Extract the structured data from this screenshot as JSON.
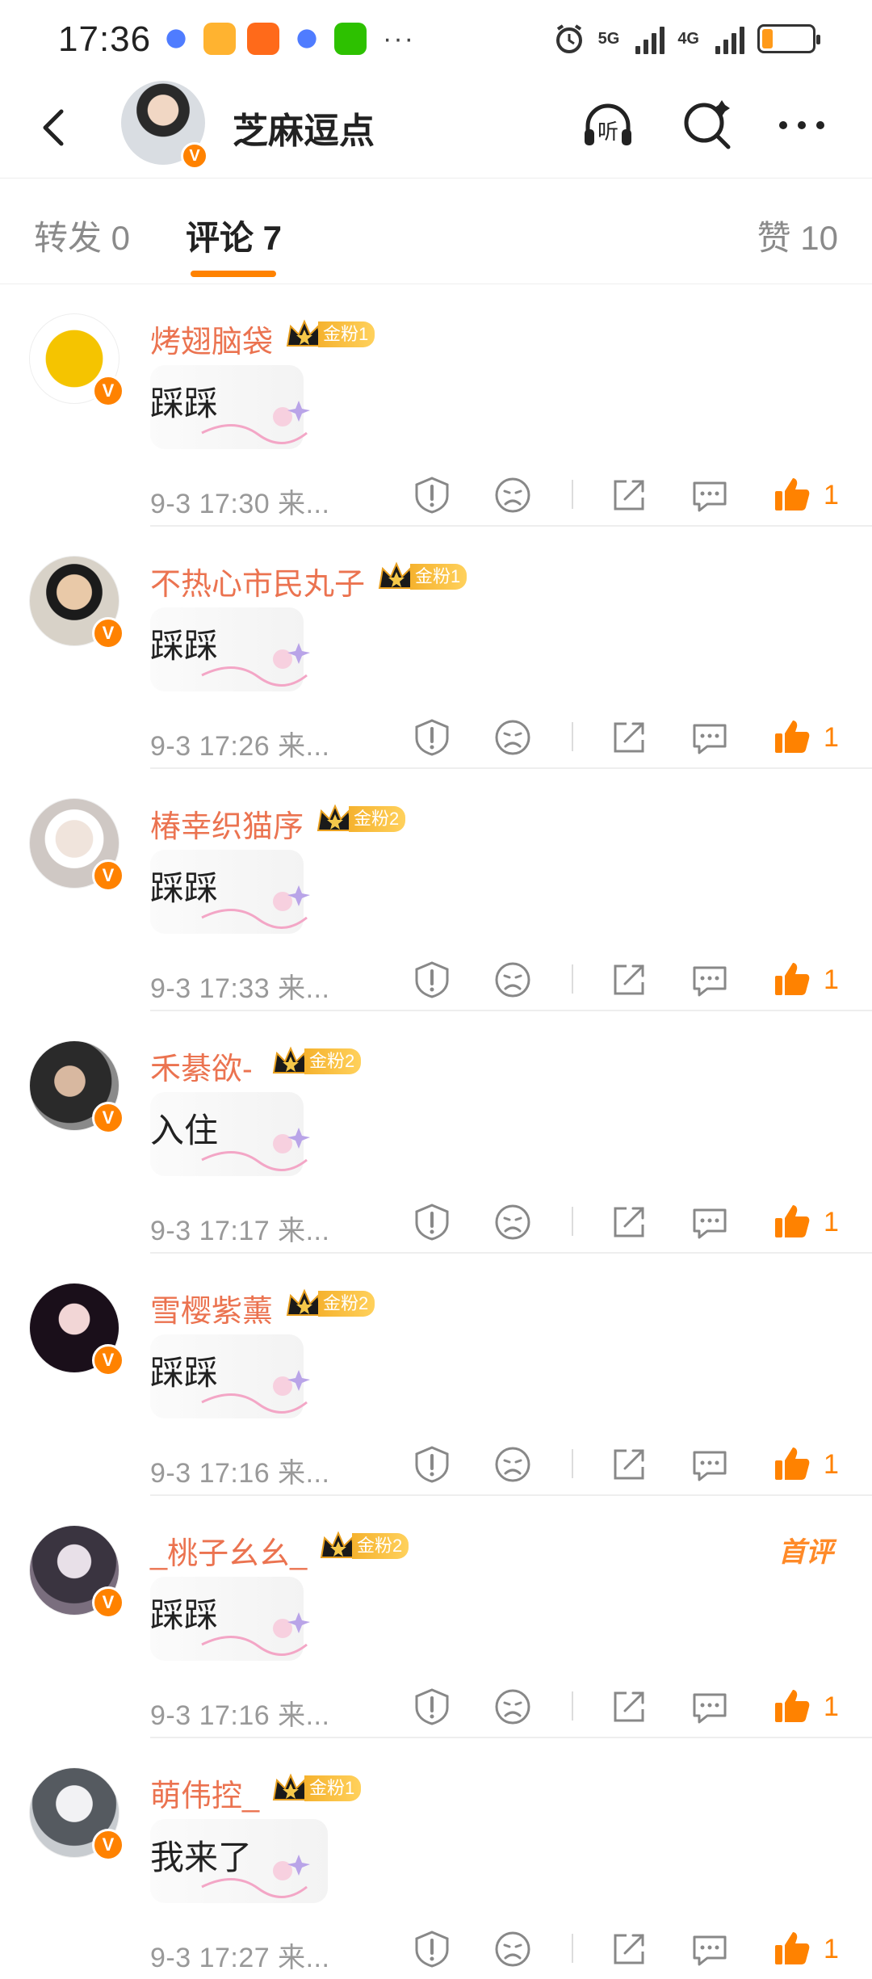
{
  "status_bar": {
    "time": "17:36",
    "more": "···",
    "network": [
      "5G",
      "4G"
    ],
    "battery_level": 0.2
  },
  "header": {
    "title": "芝麻逗点",
    "listen_label": "听",
    "more_label": "···"
  },
  "tabs": {
    "repost": "转发 0",
    "comments": "评论 7",
    "likes": "赞 10"
  },
  "accent_color": "#ff8200",
  "name_color": "#eb7350",
  "verified_mark": "V",
  "comments": [
    {
      "name": "烤翅脑袋",
      "fan": "金粉1",
      "text": "踩踩",
      "time": "9-3 17:30  来...",
      "likes": "1",
      "first": ""
    },
    {
      "name": "不热心市民丸子",
      "fan": "金粉1",
      "text": "踩踩",
      "time": "9-3 17:26  来...",
      "likes": "1",
      "first": ""
    },
    {
      "name": "椿幸织猫序",
      "fan": "金粉2",
      "text": "踩踩",
      "time": "9-3 17:33  来...",
      "likes": "1",
      "first": ""
    },
    {
      "name": "禾綦欲-",
      "fan": "金粉2",
      "text": "入住",
      "time": "9-3 17:17  来...",
      "likes": "1",
      "first": ""
    },
    {
      "name": "雪樱紫薰",
      "fan": "金粉2",
      "text": "踩踩",
      "time": "9-3 17:16  来...",
      "likes": "1",
      "first": ""
    },
    {
      "name": "_桃子幺幺_",
      "fan": "金粉2",
      "text": "踩踩",
      "time": "9-3 17:16  来...",
      "likes": "1",
      "first": "首评"
    },
    {
      "name": "萌伟控_",
      "fan": "金粉1",
      "text": "我来了",
      "time": "9-3 17:27  来...",
      "likes": "1",
      "first": ""
    }
  ]
}
